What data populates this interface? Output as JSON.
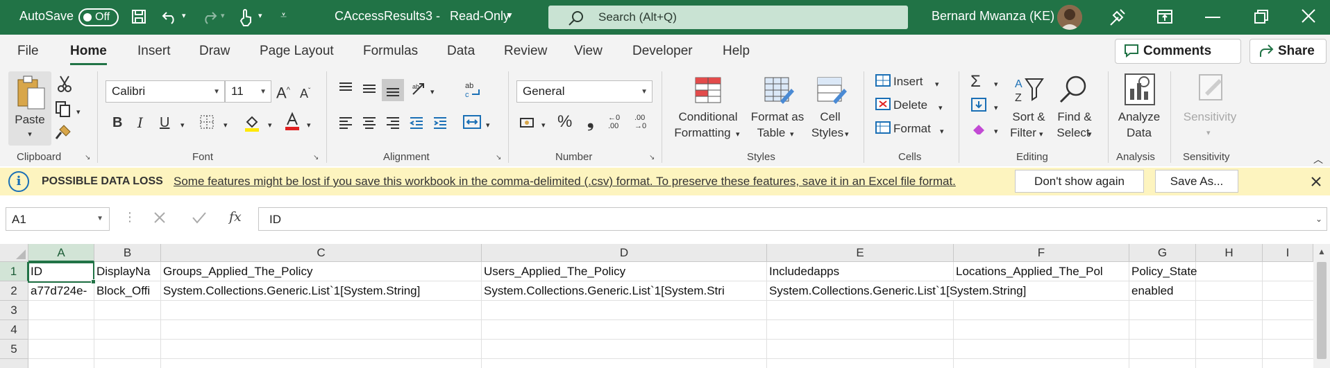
{
  "titlebar": {
    "autosave_label": "AutoSave",
    "autosave_state": "Off",
    "file_name": "CAccessResults3",
    "mode": "Read-Only",
    "search_placeholder": "Search (Alt+Q)",
    "user_name": "Bernard Mwanza (KE)",
    "accent": "#217346"
  },
  "tabs": [
    "File",
    "Home",
    "Insert",
    "Draw",
    "Page Layout",
    "Formulas",
    "Data",
    "Review",
    "View",
    "Developer",
    "Help"
  ],
  "active_tab": "Home",
  "top_buttons": {
    "comments": "Comments",
    "share": "Share"
  },
  "ribbon": {
    "clipboard": {
      "label": "Clipboard",
      "paste": "Paste"
    },
    "font": {
      "label": "Font",
      "name": "Calibri",
      "size": "11"
    },
    "alignment": {
      "label": "Alignment"
    },
    "number": {
      "label": "Number",
      "format": "General"
    },
    "styles": {
      "label": "Styles",
      "cond1": "Conditional",
      "cond2": "Formatting",
      "fmt1": "Format as",
      "fmt2": "Table",
      "cell1": "Cell",
      "cell2": "Styles"
    },
    "cells": {
      "label": "Cells",
      "insert": "Insert",
      "delete": "Delete",
      "format": "Format"
    },
    "editing": {
      "label": "Editing",
      "sort1": "Sort &",
      "sort2": "Filter",
      "find1": "Find &",
      "find2": "Select"
    },
    "analysis": {
      "label": "Analysis",
      "a1": "Analyze",
      "a2": "Data"
    },
    "sensitivity": {
      "label": "Sensitivity",
      "s1": "Sensitivity"
    }
  },
  "message": {
    "title": "POSSIBLE DATA LOSS",
    "text": "Some features might be lost if you save this workbook in the comma-delimited (.csv) format. To preserve these features, save it in an Excel file format.",
    "btn_dont": "Don't show again",
    "btn_save": "Save As..."
  },
  "formula_bar": {
    "name_box": "A1",
    "fx": "fx",
    "value": "ID"
  },
  "sheet": {
    "columns": [
      "A",
      "B",
      "C",
      "D",
      "E",
      "F",
      "G",
      "H",
      "I"
    ],
    "rows": [
      "1",
      "2",
      "3",
      "4",
      "5"
    ],
    "r1": [
      "ID",
      "DisplayNa",
      "Groups_Applied_The_Policy",
      "Users_Applied_The_Policy",
      "Includedapps",
      "Locations_Applied_The_Pol",
      "Policy_State"
    ],
    "r2": [
      "a77d724e-",
      "Block_Offi",
      "System.Collections.Generic.List`1[System.String]",
      "System.Collections.Generic.List`1[System.Stri",
      "System.Collections.Generic.List`1[System.String]",
      "enabled"
    ]
  }
}
